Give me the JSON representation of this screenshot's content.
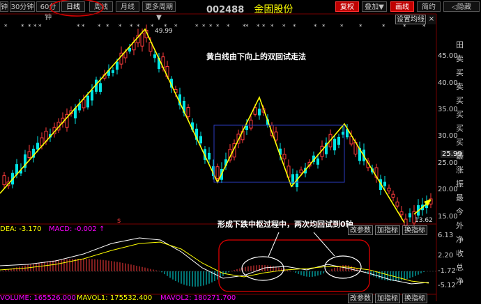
{
  "toolbar": {
    "tabs": [
      {
        "label": "钟"
      },
      {
        "label": "30分钟"
      },
      {
        "label": "60分钟"
      },
      {
        "label": "日线"
      },
      {
        "label": "周线"
      },
      {
        "label": "月线"
      },
      {
        "label": "更多周期▼"
      }
    ],
    "stock_code": "002488",
    "stock_name": "金固股份",
    "right_buttons": [
      {
        "label": "复权"
      },
      {
        "label": "叠加▼"
      },
      {
        "label": "画线"
      },
      {
        "label": "简约"
      },
      {
        "label": "◁隐藏"
      }
    ]
  },
  "settings": {
    "ma_button": "设置均线",
    "ma_close": "×"
  },
  "main_chart": {
    "annotation": "黄白线由下向上的双回试走法",
    "high_label": "49.99",
    "low_label": "13.62",
    "price_axis": [
      "45.00",
      "40.00",
      "35.00",
      "30.00",
      "25.00",
      "20.00",
      "15.00"
    ],
    "current_price": "25.99",
    "right_text": [
      "田",
      "卖",
      "买",
      "卖",
      "买",
      "买",
      "买",
      "买",
      "最",
      "涨",
      "振",
      "最",
      "今",
      "外",
      "净",
      "收",
      "总",
      "净"
    ]
  },
  "macd_panel": {
    "dea_label": "DEA: -3.170",
    "macd_label": "MACD: -0.002 ↑",
    "annotation": "形成下跌中枢过程中，两次均回试到0轴",
    "buttons": [
      "改参数",
      "加指标",
      "换指标"
    ],
    "axis": [
      "6.13",
      "2.20",
      "-1.72",
      "-5.12"
    ]
  },
  "volume_panel": {
    "volume_label": "VOLUME: 165526.000",
    "mavol1_label": "MAVOL1: 175532.400",
    "mavol2_label": "MAVOL2: 180271.700",
    "buttons": [
      "改参数",
      "加指标",
      "换指标"
    ]
  },
  "colors": {
    "up": "#ff3c3c",
    "down": "#00e5e5",
    "yellow": "#ffff00",
    "highlight_red": "#e00000",
    "box_blue": "#2b3dbf"
  }
}
